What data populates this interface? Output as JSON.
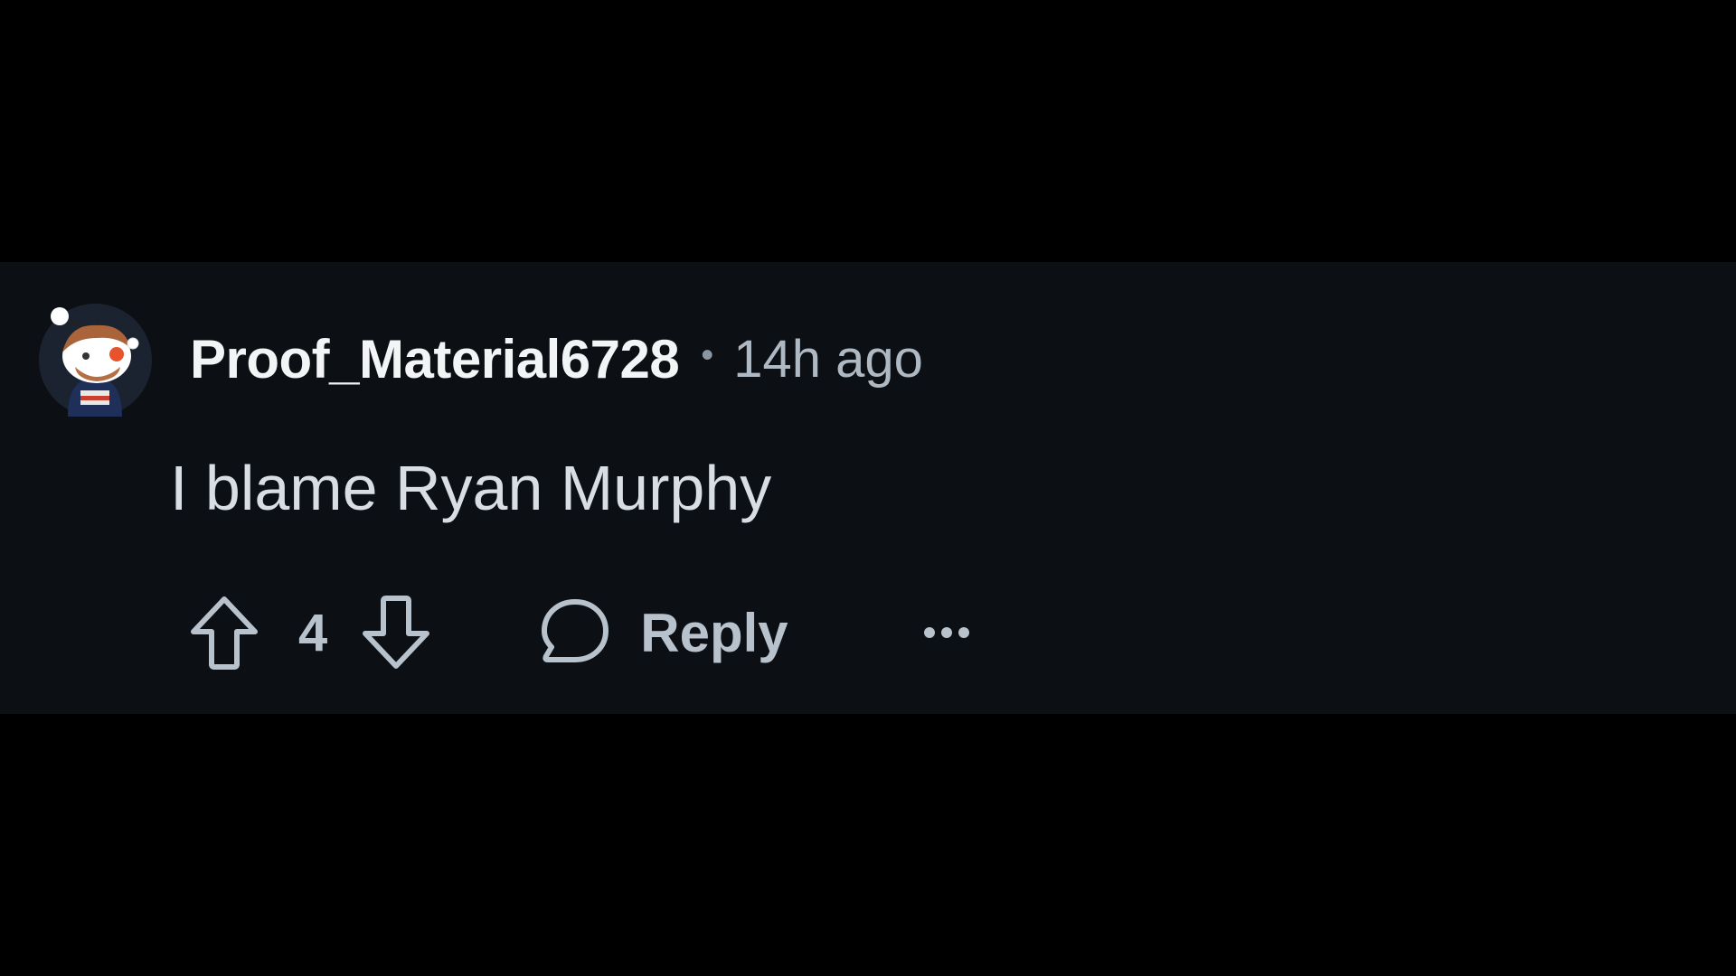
{
  "comment": {
    "username": "Proof_Material6728",
    "separator": "•",
    "timestamp": "14h ago",
    "body": "I blame Ryan Murphy",
    "vote_count": "4",
    "reply_label": "Reply"
  },
  "icons": {
    "avatar": "snoo-avatar-icon",
    "upvote": "upvote-arrow-icon",
    "downvote": "downvote-arrow-icon",
    "reply": "speech-bubble-icon",
    "more": "more-options-icon"
  },
  "colors": {
    "background": "#000000",
    "card": "#0c0f13",
    "username": "#f2f4f5",
    "muted": "#aeb9c4",
    "icon": "#b7c2cc"
  }
}
